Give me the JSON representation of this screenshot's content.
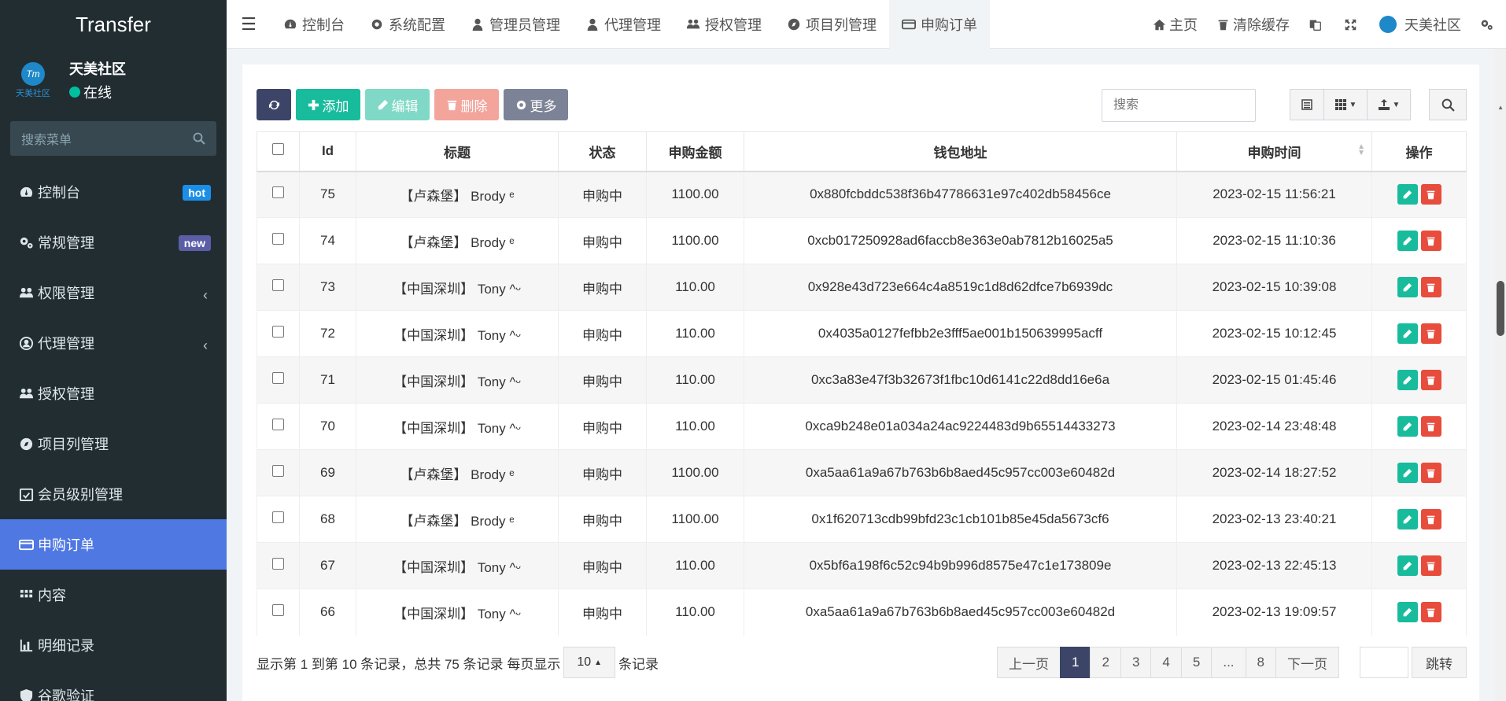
{
  "sidebar": {
    "brand": "Transfer",
    "user": {
      "name": "天美社区",
      "status": "在线",
      "avatar_sub": "天美社区",
      "avatar_mark": "Tm"
    },
    "search_placeholder": "搜索菜单",
    "items": [
      {
        "label": "控制台",
        "icon": "dashboard-icon",
        "badge": "hot"
      },
      {
        "label": "常规管理",
        "icon": "cogs-icon",
        "badge": "new"
      },
      {
        "label": "权限管理",
        "icon": "group-icon",
        "chevron": "‹"
      },
      {
        "label": "代理管理",
        "icon": "user-circle-icon",
        "chevron": "‹"
      },
      {
        "label": "授权管理",
        "icon": "users-icon"
      },
      {
        "label": "项目列管理",
        "icon": "compass-icon"
      },
      {
        "label": "会员级别管理",
        "icon": "calendar-check-icon"
      },
      {
        "label": "申购订单",
        "icon": "credit-card-icon",
        "active": true
      },
      {
        "label": "内容",
        "icon": "grid-icon"
      },
      {
        "label": "明细记录",
        "icon": "bar-chart-icon"
      },
      {
        "label": "谷歌验证",
        "icon": "shield-icon"
      }
    ]
  },
  "topnav": {
    "tabs": [
      "控制台",
      "系统配置",
      "管理员管理",
      "代理管理",
      "授权管理",
      "项目列管理",
      "申购订单"
    ],
    "right": {
      "home": "主页",
      "clear_cache": "清除缓存",
      "community": "天美社区"
    }
  },
  "toolbar": {
    "add": "添加",
    "edit": "编辑",
    "delete": "删除",
    "more": "更多"
  },
  "search": {
    "placeholder": "搜索"
  },
  "table": {
    "headers": [
      "Id",
      "标题",
      "状态",
      "申购金额",
      "钱包地址",
      "申购时间",
      "操作"
    ],
    "rows": [
      {
        "id": "75",
        "title": "【卢森堡】 Brody ᵉ",
        "status": "申购中",
        "amount": "1100.00",
        "wallet": "0x880fcbddc538f36b47786631e97c402db58456ce",
        "time": "2023-02-15 11:56:21"
      },
      {
        "id": "74",
        "title": "【卢森堡】 Brody ᵉ",
        "status": "申购中",
        "amount": "1100.00",
        "wallet": "0xcb017250928ad6faccb8e363e0ab7812b16025a5",
        "time": "2023-02-15 11:10:36"
      },
      {
        "id": "73",
        "title": "【中国深圳】 Tony ^ᵕ",
        "status": "申购中",
        "amount": "110.00",
        "wallet": "0x928e43d723e664c4a8519c1d8d62dfce7b6939dc",
        "time": "2023-02-15 10:39:08"
      },
      {
        "id": "72",
        "title": "【中国深圳】 Tony ^ᵕ",
        "status": "申购中",
        "amount": "110.00",
        "wallet": "0x4035a0127fefbb2e3fff5ae001b150639995acff",
        "time": "2023-02-15 10:12:45"
      },
      {
        "id": "71",
        "title": "【中国深圳】 Tony ^ᵕ",
        "status": "申购中",
        "amount": "110.00",
        "wallet": "0xc3a83e47f3b32673f1fbc10d6141c22d8dd16e6a",
        "time": "2023-02-15 01:45:46"
      },
      {
        "id": "70",
        "title": "【中国深圳】 Tony ^ᵕ",
        "status": "申购中",
        "amount": "110.00",
        "wallet": "0xca9b248e01a034a24ac9224483d9b65514433273",
        "time": "2023-02-14 23:48:48"
      },
      {
        "id": "69",
        "title": "【卢森堡】 Brody ᵉ",
        "status": "申购中",
        "amount": "1100.00",
        "wallet": "0xa5aa61a9a67b763b6b8aed45c957cc003e60482d",
        "time": "2023-02-14 18:27:52"
      },
      {
        "id": "68",
        "title": "【卢森堡】 Brody ᵉ",
        "status": "申购中",
        "amount": "1100.00",
        "wallet": "0x1f620713cdb99bfd23c1cb101b85e45da5673cf6",
        "time": "2023-02-13 23:40:21"
      },
      {
        "id": "67",
        "title": "【中国深圳】 Tony ^ᵕ",
        "status": "申购中",
        "amount": "110.00",
        "wallet": "0x5bf6a198f6c52c94b9b996d8575e47c1e173809e",
        "time": "2023-02-13 22:45:13"
      },
      {
        "id": "66",
        "title": "【中国深圳】 Tony ^ᵕ",
        "status": "申购中",
        "amount": "110.00",
        "wallet": "0xa5aa61a9a67b763b6b8aed45c957cc003e60482d",
        "time": "2023-02-13 19:09:57"
      }
    ]
  },
  "footer": {
    "info_prefix": "显示第 1 到第 10 条记录，总共 75 条记录 每页显示",
    "page_size": "10",
    "info_suffix": "条记录",
    "pages": [
      "上一页",
      "1",
      "2",
      "3",
      "4",
      "5",
      "...",
      "8",
      "下一页"
    ],
    "current_page": "1",
    "goto": "跳转"
  }
}
